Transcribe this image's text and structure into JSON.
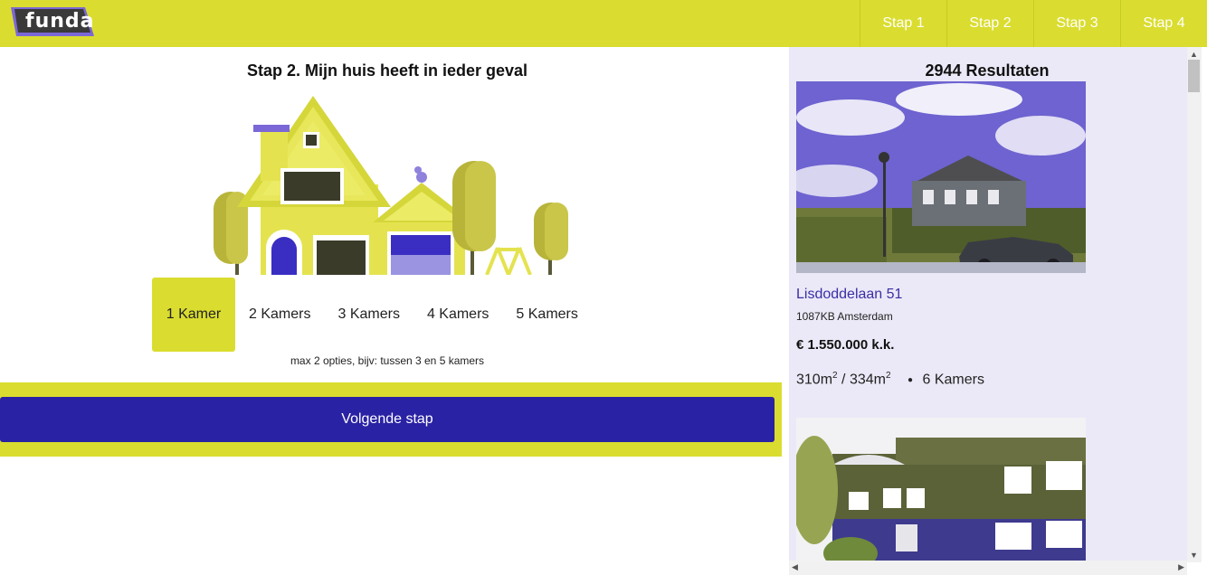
{
  "header": {
    "logo_text": "funda",
    "steps": [
      "Stap 1",
      "Stap 2",
      "Stap 3",
      "Stap 4"
    ]
  },
  "main": {
    "title": "Stap 2. Mijn huis heeft in ieder geval",
    "kamers": [
      "1 Kamer",
      "2 Kamers",
      "3 Kamers",
      "4 Kamers",
      "5 Kamers"
    ],
    "hint": "max 2 opties, bijv: tussen 3 en 5 kamers",
    "next_label": "Volgende stap"
  },
  "results": {
    "title": "2944 Resultaten",
    "listing": {
      "street": "Lisdoddelaan 51",
      "city": "1087KB Amsterdam",
      "price": "€ 1.550.000 k.k.",
      "area_living": "310m",
      "area_plot": "334m",
      "sup": "2",
      "separator": "/",
      "rooms": "6 Kamers"
    }
  },
  "colors": {
    "brand_yellow": "#dadd2f",
    "brand_blue": "#2a22a4",
    "panel_bg": "#ebe9f7"
  }
}
